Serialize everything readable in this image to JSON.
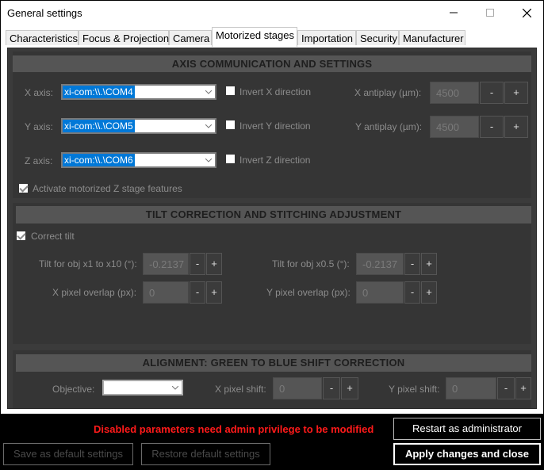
{
  "window": {
    "title": "General settings"
  },
  "tabs": [
    {
      "label": "Characteristics",
      "active": false
    },
    {
      "label": "Focus & Projection",
      "active": false
    },
    {
      "label": "Camera",
      "active": false
    },
    {
      "label": "Motorized stages",
      "active": true
    },
    {
      "label": "Importation",
      "active": false
    },
    {
      "label": "Security",
      "active": false
    },
    {
      "label": "Manufacturer",
      "active": false
    }
  ],
  "axis": {
    "header": "AXIS COMMUNICATION AND SETTINGS",
    "x": {
      "label": "X axis:",
      "value": "xi-com:\\\\.\\COM4",
      "invert_label": "Invert X direction",
      "antiplay_label": "X antiplay (µm):",
      "antiplay_value": "4500"
    },
    "y": {
      "label": "Y axis:",
      "value": "xi-com:\\\\.\\COM5",
      "invert_label": "Invert Y direction",
      "antiplay_label": "Y antiplay (µm):",
      "antiplay_value": "4500"
    },
    "z": {
      "label": "Z axis:",
      "value": "xi-com:\\\\.\\COM6",
      "invert_label": "Invert Z direction"
    },
    "activate_z_label": "Activate motorized Z stage features"
  },
  "tilt": {
    "header": "TILT CORRECTION AND STITCHING ADJUSTMENT",
    "correct_tilt_label": "Correct tilt",
    "tilt_x1_label": "Tilt for obj x1 to x10 (°):",
    "tilt_x1_value": "-0.2137",
    "tilt_x05_label": "Tilt for obj x0.5 (°):",
    "tilt_x05_value": "-0.2137",
    "x_overlap_label": "X pixel overlap (px):",
    "x_overlap_value": "0",
    "y_overlap_label": "Y pixel overlap (px):",
    "y_overlap_value": "0"
  },
  "alignment": {
    "header": "ALIGNMENT: GREEN TO BLUE SHIFT CORRECTION",
    "objective_label": "Objective:",
    "x_shift_label": "X pixel shift:",
    "x_shift_value": "0",
    "y_shift_label": "Y pixel shift:",
    "y_shift_value": "0"
  },
  "stepper": {
    "minus": "-",
    "plus": "+"
  },
  "footer": {
    "message": "Disabled parameters need admin privilege to be modified",
    "restart_admin": "Restart as administrator",
    "save_default": "Save as default settings",
    "restore_default": "Restore default settings",
    "apply_close": "Apply changes and close"
  },
  "colors": {
    "warning": "#ff1a1a",
    "selection": "#0078d7",
    "panel": "#3b3b3b",
    "header": "#555555"
  }
}
